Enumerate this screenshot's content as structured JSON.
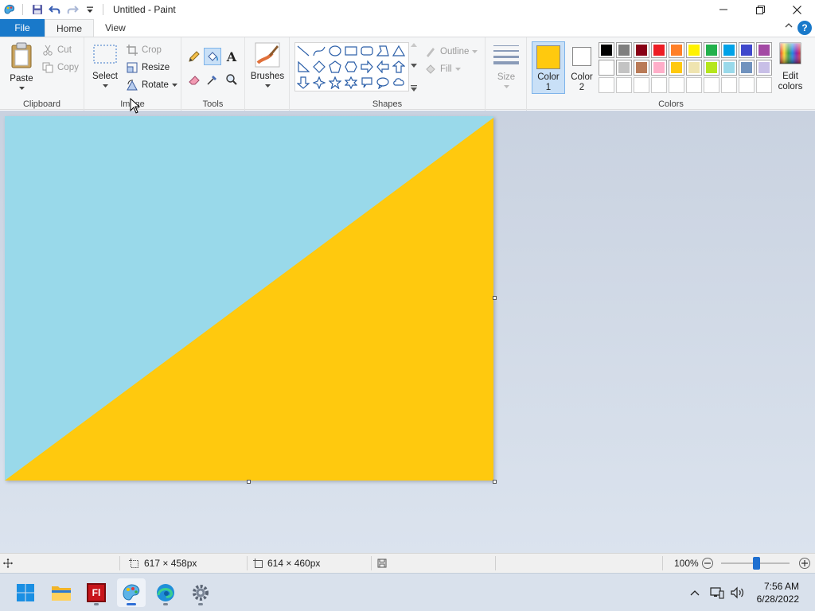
{
  "titlebar": {
    "title": "Untitled - Paint",
    "quick_access": [
      "paint-app-icon",
      "save-icon",
      "undo-icon",
      "redo-icon",
      "customize-dropdown-icon"
    ],
    "controls": [
      "minimize-icon",
      "maximize-icon",
      "close-icon"
    ]
  },
  "tabs": {
    "file": "File",
    "home": "Home",
    "view": "View",
    "help_icon": "?"
  },
  "ribbon": {
    "clipboard": {
      "label": "Clipboard",
      "paste": "Paste",
      "cut": "Cut",
      "copy": "Copy"
    },
    "image": {
      "label": "Image",
      "select": "Select",
      "crop": "Crop",
      "resize": "Resize",
      "rotate": "Rotate"
    },
    "tools": {
      "label": "Tools",
      "items": [
        "pencil-icon",
        "fill-bucket-icon",
        "text-icon",
        "eraser-icon",
        "color-picker-icon",
        "magnifier-icon"
      ],
      "selected": "fill-bucket-icon"
    },
    "brushes": {
      "label": "Brushes"
    },
    "shapes": {
      "label": "Shapes",
      "outline": "Outline",
      "fill": "Fill"
    },
    "size": {
      "label": "Size"
    },
    "colors": {
      "label": "Colors",
      "color1": {
        "label_line1": "Color",
        "label_line2": "1",
        "value": "#FFC90E"
      },
      "color2": {
        "label_line1": "Color",
        "label_line2": "2",
        "value": "#FFFFFF"
      },
      "edit": {
        "label_line1": "Edit",
        "label_line2": "colors"
      },
      "palette_row1": [
        "#000000",
        "#7F7F7F",
        "#880015",
        "#ED1C24",
        "#FF7F27",
        "#FFF200",
        "#22B14C",
        "#00A2E8",
        "#3F48CC",
        "#A349A4"
      ],
      "palette_row2": [
        "#FFFFFF",
        "#C3C3C3",
        "#B97A57",
        "#FFAEC9",
        "#FFC90E",
        "#EFE4B0",
        "#B5E61D",
        "#99D9EA",
        "#7092BE",
        "#C8BFE7"
      ],
      "palette_row3": [
        "",
        "",
        "",
        "",
        "",
        "",
        "",
        "",
        "",
        ""
      ]
    }
  },
  "canvas": {
    "background_color": "#99D9EA",
    "triangle_color": "#FFC90E"
  },
  "statusbar": {
    "selection_size": "617 × 458px",
    "image_size": "614 × 460px",
    "zoom": "100%"
  },
  "taskbar": {
    "apps": [
      "start-icon",
      "file-explorer-icon",
      "flash-app-icon",
      "paint-app-icon",
      "edge-browser-icon",
      "settings-icon"
    ],
    "active_app": "paint-app-icon",
    "flash_label": "Fl",
    "time": "7:56 AM",
    "date": "6/28/2022"
  }
}
